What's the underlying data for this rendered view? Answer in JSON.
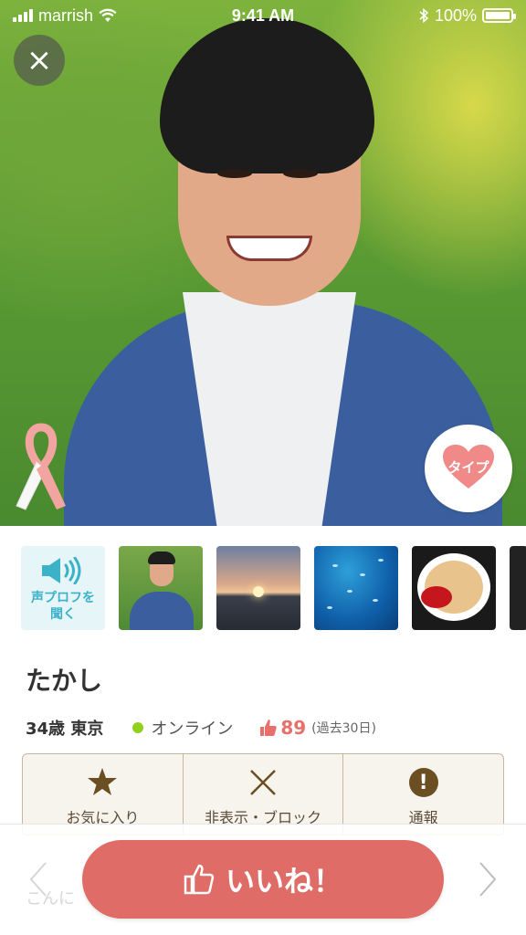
{
  "status_bar": {
    "carrier": "marrish",
    "time": "9:41 AM",
    "battery_percent": "100%"
  },
  "hero": {
    "close_label": "×",
    "type_label": "タイプ"
  },
  "voice_profile": {
    "label": "声プロフを聞く"
  },
  "thumbnails": [
    {
      "icon": "person-photo"
    },
    {
      "icon": "sunset-photo"
    },
    {
      "icon": "underwater-photo"
    },
    {
      "icon": "ramen-photo"
    },
    {
      "icon": "night-photo"
    }
  ],
  "profile": {
    "name": "たかし",
    "age_location": "34歳 東京",
    "online_status": "オンライン",
    "likes_count": "89",
    "likes_period": "(過去30日)"
  },
  "actions": {
    "favorite": "お気に入り",
    "hide_block": "非表示・ブロック",
    "report": "通報"
  },
  "bottom": {
    "peek_text": "こんに",
    "like_button": "いいね！"
  },
  "colors": {
    "like": "#df6c66",
    "online": "#8fd11c",
    "voice": "#3bb2c8",
    "action_text": "#5b4a36"
  }
}
